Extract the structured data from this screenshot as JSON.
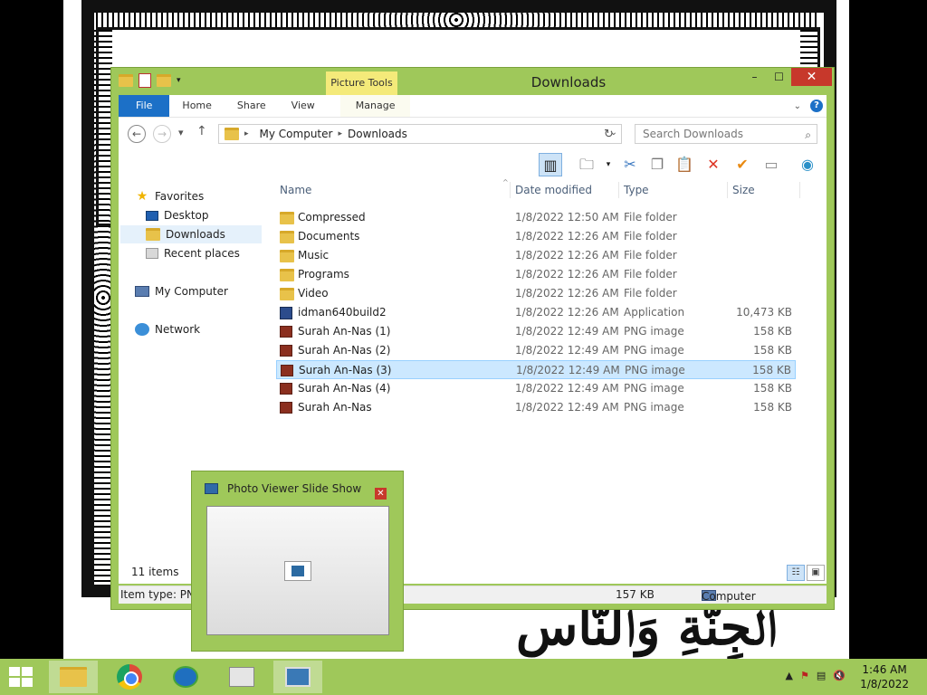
{
  "window": {
    "title": "Downloads",
    "contextual_tab_group": "Picture Tools",
    "controls": {
      "minimize": "–",
      "maximize": "☐",
      "close": "✕"
    }
  },
  "ribbon": {
    "tabs": [
      "File",
      "Home",
      "Share",
      "View",
      "Manage"
    ],
    "help": "?"
  },
  "address": {
    "segments": [
      "My Computer",
      "Downloads"
    ],
    "search_placeholder": "Search Downloads"
  },
  "navpane": {
    "favorites": "Favorites",
    "desktop": "Desktop",
    "downloads": "Downloads",
    "recent": "Recent places",
    "computer": "My Computer",
    "network": "Network"
  },
  "columns": {
    "name": "Name",
    "date": "Date modified",
    "type": "Type",
    "size": "Size"
  },
  "files": [
    {
      "name": "Compressed",
      "date": "1/8/2022 12:50 AM",
      "type": "File folder",
      "size": "",
      "kind": "folder"
    },
    {
      "name": "Documents",
      "date": "1/8/2022 12:26 AM",
      "type": "File folder",
      "size": "",
      "kind": "folder"
    },
    {
      "name": "Music",
      "date": "1/8/2022 12:26 AM",
      "type": "File folder",
      "size": "",
      "kind": "folder"
    },
    {
      "name": "Programs",
      "date": "1/8/2022 12:26 AM",
      "type": "File folder",
      "size": "",
      "kind": "folder"
    },
    {
      "name": "Video",
      "date": "1/8/2022 12:26 AM",
      "type": "File folder",
      "size": "",
      "kind": "folder"
    },
    {
      "name": "idman640build2",
      "date": "1/8/2022 12:26 AM",
      "type": "Application",
      "size": "10,473 KB",
      "kind": "app"
    },
    {
      "name": "Surah An-Nas (1)",
      "date": "1/8/2022 12:49 AM",
      "type": "PNG image",
      "size": "158 KB",
      "kind": "png"
    },
    {
      "name": "Surah An-Nas (2)",
      "date": "1/8/2022 12:49 AM",
      "type": "PNG image",
      "size": "158 KB",
      "kind": "png"
    },
    {
      "name": "Surah An-Nas (3)",
      "date": "1/8/2022 12:49 AM",
      "type": "PNG image",
      "size": "158 KB",
      "kind": "png",
      "selected": true
    },
    {
      "name": "Surah An-Nas (4)",
      "date": "1/8/2022 12:49 AM",
      "type": "PNG image",
      "size": "158 KB",
      "kind": "png"
    },
    {
      "name": "Surah An-Nas",
      "date": "1/8/2022 12:49 AM",
      "type": "PNG image",
      "size": "158 KB",
      "kind": "png"
    }
  ],
  "status": {
    "items_count": "11 items",
    "item_type": "Item type: PNG",
    "size": "157 KB",
    "location": "Computer"
  },
  "photo_viewer": {
    "title": "Photo Viewer Slide Show",
    "close": "✕"
  },
  "taskbar": {
    "time": "1:46 AM",
    "date": "1/8/2022"
  },
  "colors": {
    "accent": "#9fc85a",
    "file_tab": "#1c70c7",
    "selection": "#cce8ff",
    "close": "#c7382b"
  }
}
